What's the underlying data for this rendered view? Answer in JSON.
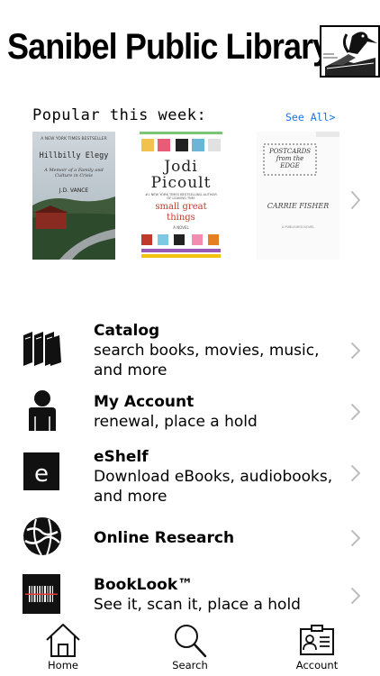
{
  "header": {
    "title": "Sanibel Public Library"
  },
  "popular": {
    "title": "Popular this week:",
    "see_all": "See All>",
    "books": [
      {
        "top_line": "A NEW YORK TIMES BESTSELLER",
        "title": "Hillbilly Elegy",
        "subtitle": "A Memoir of a Family and Culture in Crisis",
        "author": "J.D. VANCE"
      },
      {
        "author_first": "Jodi",
        "author_last": "Picoult",
        "blurb": "#1 NEW YORK TIMES BESTSELLING AUTHOR OF LEAVING TIME",
        "title": "small great things",
        "tag": "A NOVEL"
      },
      {
        "title": "POSTCARDS from the EDGE",
        "author": "CARRIE FISHER",
        "footer": "A PUBLISHED NOVEL"
      }
    ]
  },
  "menu": {
    "items": [
      {
        "title": "Catalog",
        "subtitle": "search books, movies, music, and more",
        "icon": "books-icon"
      },
      {
        "title": "My Account",
        "subtitle": "renewal, place a hold",
        "icon": "person-icon"
      },
      {
        "title": "eShelf",
        "subtitle": "Download eBooks, audiobooks, and more",
        "icon": "ebook-icon"
      },
      {
        "title": "Online Research",
        "subtitle": "",
        "icon": "globe-icon"
      },
      {
        "title": "BookLook™",
        "subtitle": "See it, scan it, place a hold",
        "icon": "barcode-icon"
      }
    ]
  },
  "tabs": [
    {
      "label": "Home",
      "icon": "home-icon"
    },
    {
      "label": "Search",
      "icon": "search-icon"
    },
    {
      "label": "Account",
      "icon": "account-card-icon"
    }
  ],
  "colors": {
    "link": "#1a73e8",
    "chevron": "#bdbdbd",
    "text": "#000000"
  }
}
